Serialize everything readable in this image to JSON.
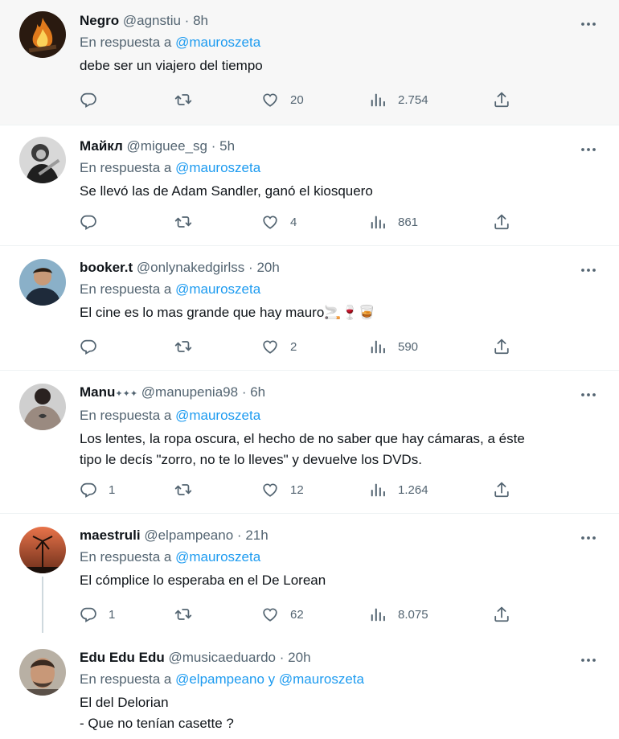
{
  "tweets": [
    {
      "name": "Negro",
      "handle": "@agnstiu",
      "sep": "·",
      "time": "8h",
      "reply_prefix": "En respuesta a",
      "reply_mention": "@mauroszeta",
      "text_lines": [
        "debe ser un viajero del tiempo"
      ],
      "replies": "",
      "retweets": "",
      "likes": "20",
      "views": "2.754",
      "avatar": "campfire-avatar"
    },
    {
      "name": "Майкл",
      "handle": "@miguee_sg",
      "sep": "·",
      "time": "5h",
      "reply_prefix": "En respuesta a",
      "reply_mention": "@mauroszeta",
      "text_lines": [
        "Se llevó las de Adam Sandler, ganó el kiosquero"
      ],
      "replies": "",
      "retweets": "",
      "likes": "4",
      "views": "861",
      "avatar": "guitarist-avatar"
    },
    {
      "name": "booker.t",
      "handle": "@onlynakedgirlss",
      "sep": "·",
      "time": "20h",
      "reply_prefix": "En respuesta a",
      "reply_mention": "@mauroszeta",
      "text_lines": [
        "El cine es lo mas grande que hay mauro🚬🍷🥃"
      ],
      "replies": "",
      "retweets": "",
      "likes": "2",
      "views": "590",
      "avatar": "person-avatar"
    },
    {
      "name": "Manu",
      "name_suffix": "✦✦✦",
      "handle": "@manupenia98",
      "sep": "·",
      "time": "6h",
      "reply_prefix": "En respuesta a",
      "reply_mention": "@mauroszeta",
      "text_lines": [
        "Los lentes, la ropa oscura, el hecho de no saber que hay cámaras, a éste",
        "tipo le decís \"zorro, no te lo lleves\" y devuelve los DVDs."
      ],
      "replies": "1",
      "retweets": "",
      "likes": "12",
      "views": "1.264",
      "avatar": "tattoo-avatar"
    },
    {
      "name": "maestruli",
      "handle": "@elpampeano",
      "sep": "·",
      "time": "21h",
      "reply_prefix": "En respuesta a",
      "reply_mention": "@mauroszeta",
      "text_lines": [
        "El cómplice lo esperaba en el De Lorean"
      ],
      "replies": "1",
      "retweets": "",
      "likes": "62",
      "views": "8.075",
      "avatar": "windmill-sunset-avatar"
    },
    {
      "name": "Edu Edu Edu",
      "handle": "@musicaeduardo",
      "sep": "·",
      "time": "20h",
      "reply_prefix": "En respuesta a",
      "reply_mention": "@elpampeano y @mauroszeta",
      "text_lines": [
        "El del Delorian",
        "- Que no tenían casette ?"
      ],
      "avatar": "face-avatar"
    }
  ],
  "icons": {
    "more": "more-dots-icon",
    "reply": "reply-icon",
    "retweet": "retweet-icon",
    "like": "heart-icon",
    "views": "views-icon",
    "share": "share-icon"
  },
  "colors": {
    "link": "#1d9bf0",
    "secondary": "#536471",
    "highlight_bg": "#f7f7f7"
  }
}
